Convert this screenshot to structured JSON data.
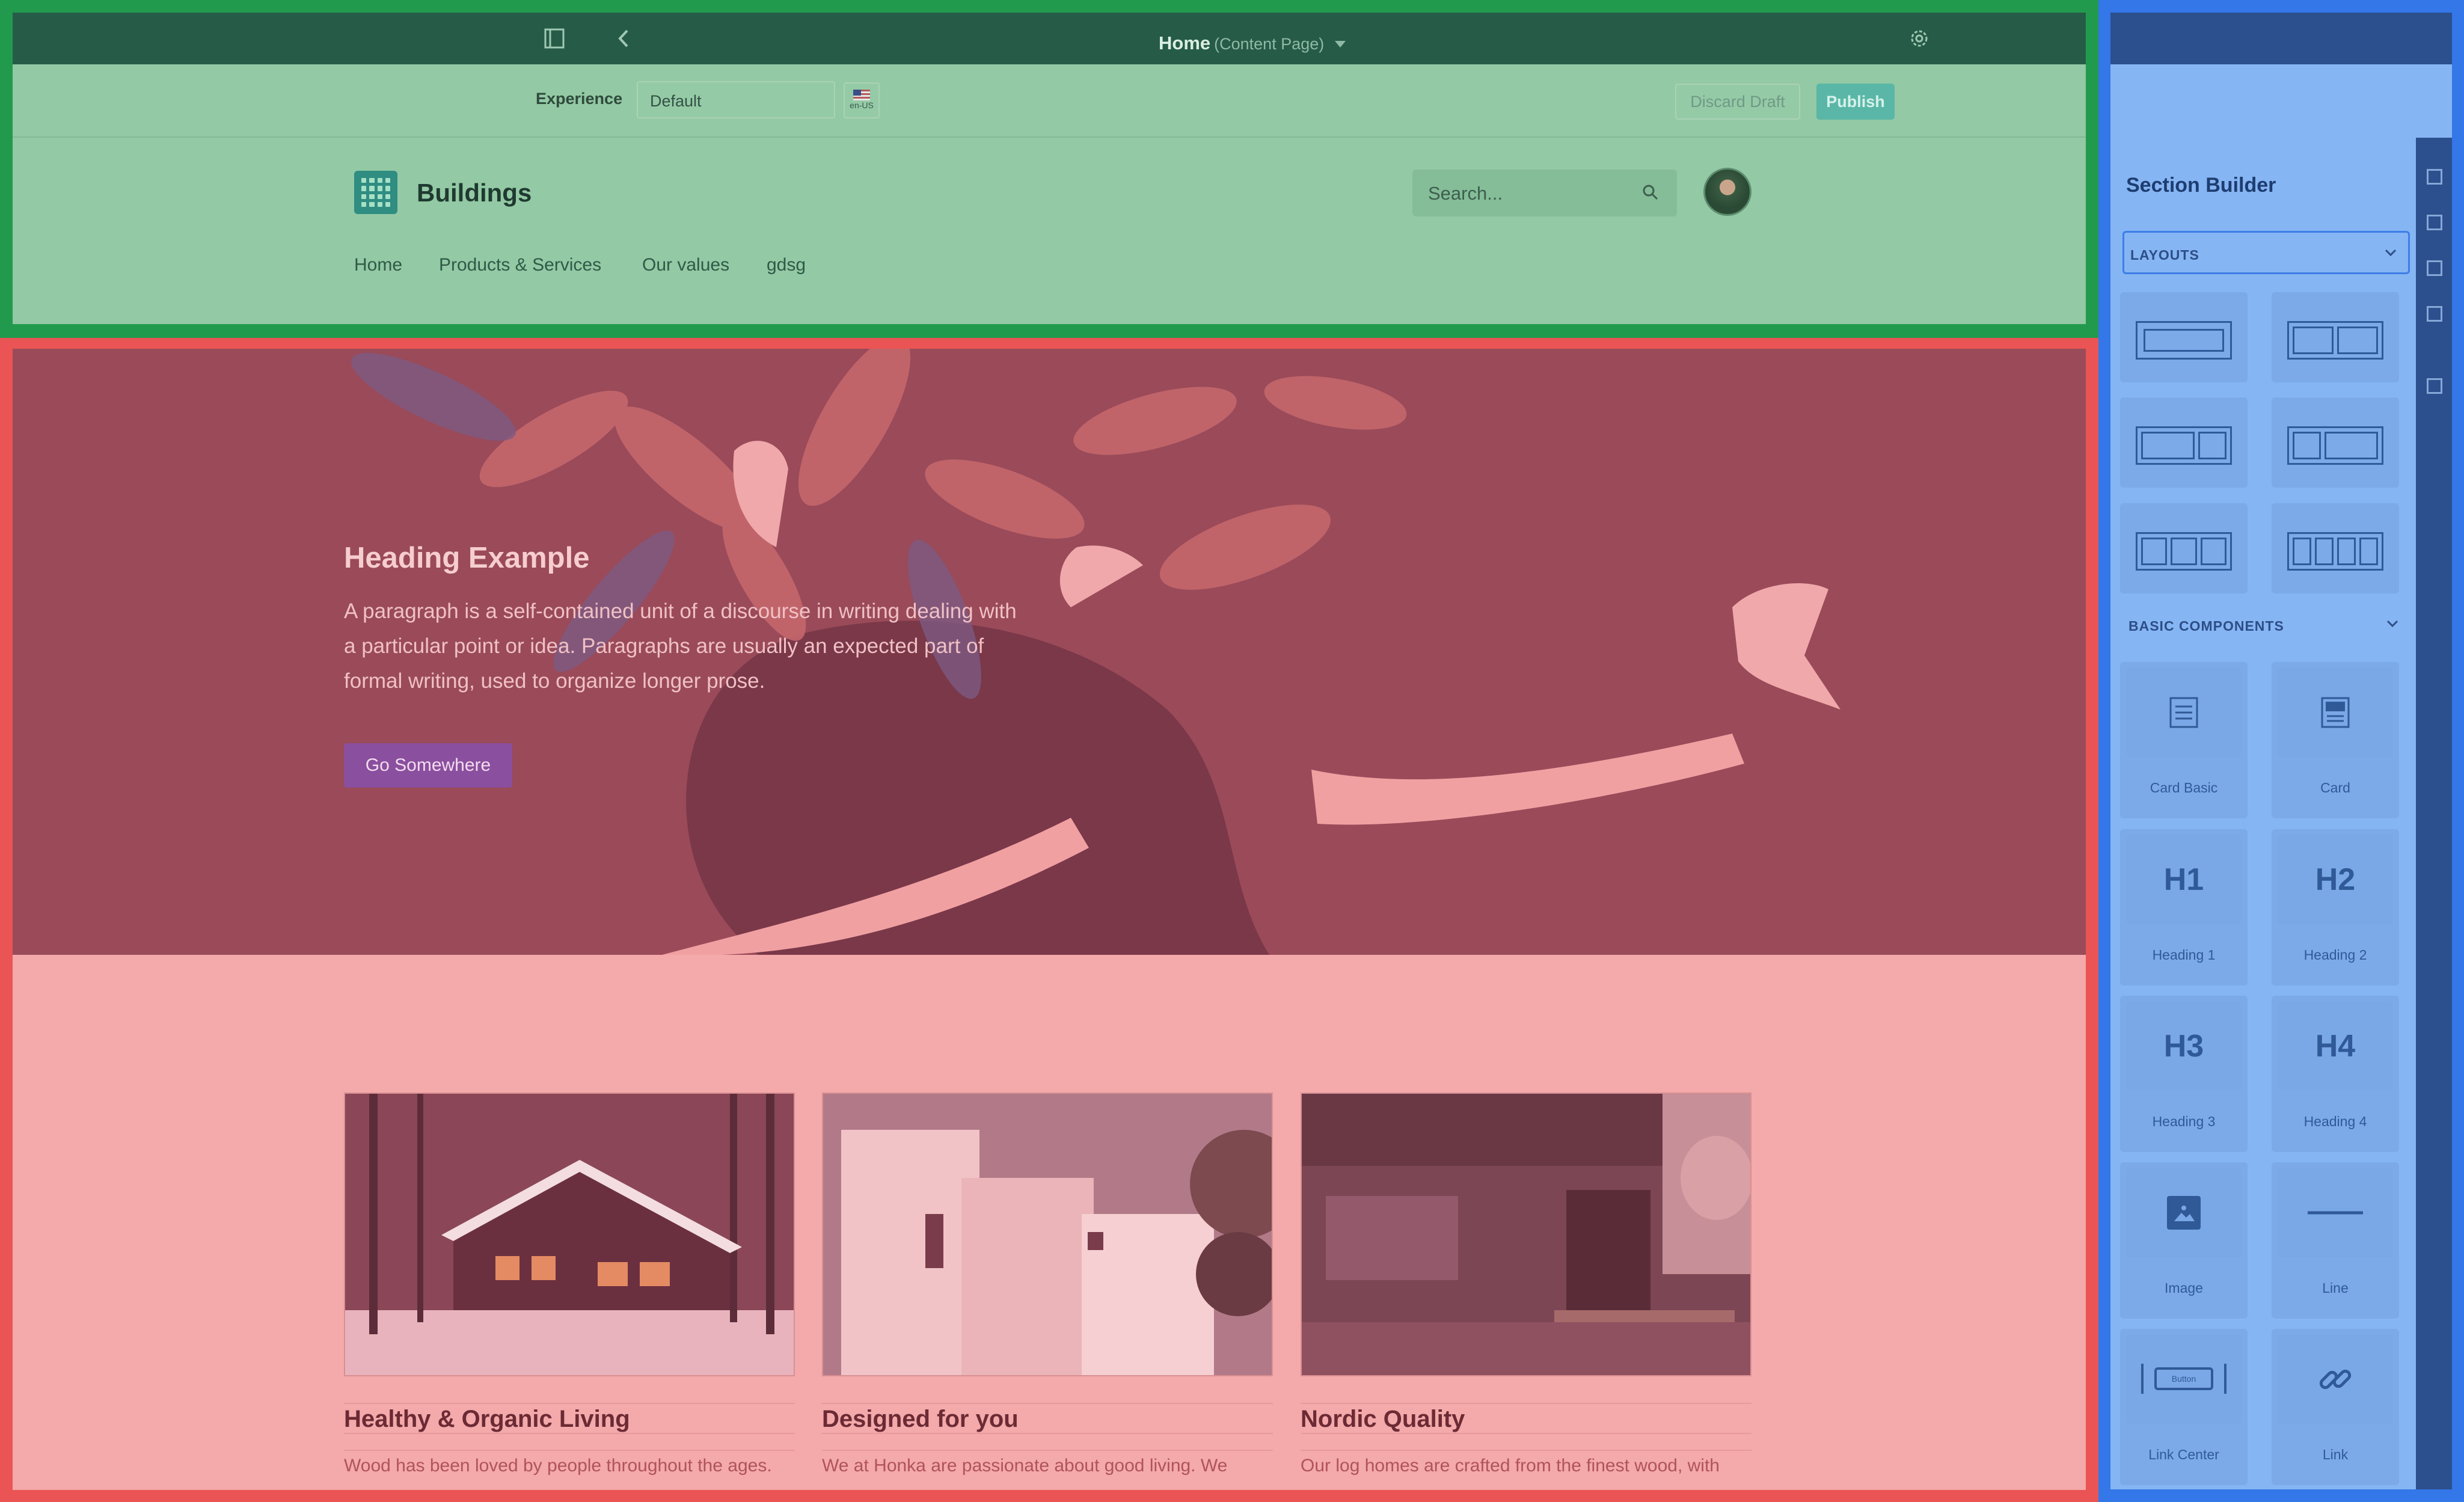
{
  "topbar": {
    "page_title": "Home",
    "page_type": "(Content Page)",
    "icons": [
      "sidebar-toggle-icon",
      "back-icon",
      "settings-icon"
    ]
  },
  "experience_bar": {
    "label": "Experience",
    "selected": "Default",
    "locale": "en-US",
    "discard_label": "Discard Draft",
    "publish_label": "Publish"
  },
  "site": {
    "brand": "Buildings",
    "search_placeholder": "Search...",
    "nav": [
      "Home",
      "Products & Services",
      "Our values",
      "gdsg"
    ]
  },
  "hero": {
    "heading": "Heading Example",
    "paragraph": "A paragraph is a self-contained unit of a discourse in writing dealing with a particular point or idea. Paragraphs are usually an expected part of formal writing, used to organize longer prose.",
    "button": "Go Somewhere"
  },
  "cards": [
    {
      "title": "Healthy & Organic Living",
      "text": "Wood has been loved by people throughout the ages."
    },
    {
      "title": "Designed for you",
      "text": "We at Honka are passionate about good living. We"
    },
    {
      "title": "Nordic Quality",
      "text": "Our log homes are crafted from the finest wood, with"
    }
  ],
  "panel": {
    "title": "Section Builder",
    "layouts_label": "LAYOUTS",
    "basic_label": "BASIC COMPONENTS",
    "components": [
      "Card Basic",
      "Card",
      "Heading 1",
      "Heading 2",
      "Heading 3",
      "Heading 4",
      "Image",
      "Line",
      "Link Center",
      "Link"
    ],
    "heading_icons": [
      "H1",
      "H2",
      "H3",
      "H4"
    ],
    "button_icon_text": "Button"
  },
  "colors": {
    "frame_green": "#229a4d",
    "frame_red": "#ea5454",
    "frame_blue": "#3377e8",
    "hero_button": "#8a4f9e",
    "publish": "#5ab7a7"
  }
}
